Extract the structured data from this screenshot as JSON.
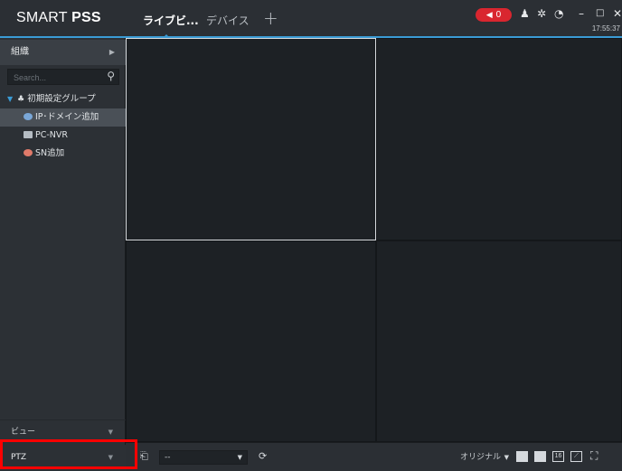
{
  "app": {
    "brand_prefix": "SMART ",
    "brand_bold": "PSS",
    "tabs": [
      {
        "label": "ライブビ...",
        "active": true
      },
      {
        "label": "デバイス",
        "active": false
      }
    ],
    "add_tab_symbol": "+",
    "alarm_count": "0",
    "clock": "17:55:37"
  },
  "titlebar_icons": {
    "user": "user-icon",
    "settings": "gear-icon",
    "performance": "gauge-icon",
    "minimize": "minimize-icon",
    "maximize": "maximize-icon",
    "close": "close-icon"
  },
  "sidebar": {
    "header": "組織",
    "search_placeholder": "Search...",
    "tree": {
      "root": "初期設定グループ",
      "children": [
        {
          "label": "IP･ドメイン追加",
          "icon": "ip-device-icon",
          "selected": true
        },
        {
          "label": "PC-NVR",
          "icon": "pc-nvr-icon",
          "selected": false
        },
        {
          "label": "SN追加",
          "icon": "sn-device-icon",
          "selected": false
        }
      ]
    },
    "view_label": "ビュー",
    "ptz_label": "PTZ"
  },
  "toolbar": {
    "view_select_value": "--",
    "ratio_label": "オリジナル",
    "layout_16_label": "16"
  },
  "colors": {
    "accent": "#3a9bd5",
    "alarm": "#d9262f",
    "highlight": "#ff0000"
  }
}
